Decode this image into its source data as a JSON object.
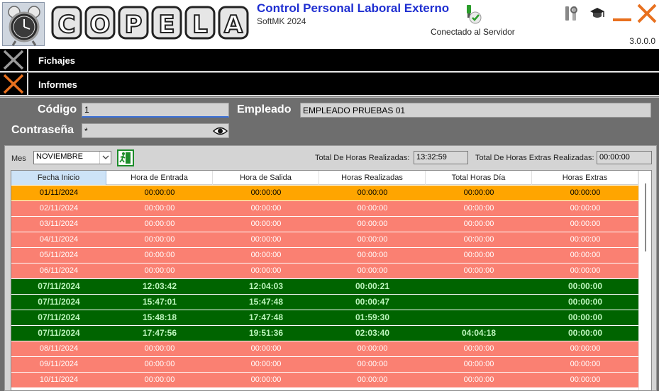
{
  "header": {
    "app_title": "Control Personal Laboral Externo",
    "app_subtitle": "SoftMK 2024",
    "connection_status": "Conectado al Servidor",
    "version": "3.0.0.0",
    "logo_letters": [
      "C",
      "O",
      "P",
      "E",
      "L",
      "A"
    ],
    "icons": [
      "clock-logo-icon",
      "server-connected-icon",
      "tools-icon",
      "graduation-cap-icon",
      "minimize-icon",
      "close-icon"
    ]
  },
  "menu": {
    "items": [
      {
        "label": "Fichajes",
        "icon": "cross-icon",
        "color": "#9a9a9a"
      },
      {
        "label": "Informes",
        "icon": "cross-icon",
        "color": "#e8701e"
      }
    ]
  },
  "form": {
    "codigo_label": "Código",
    "codigo_value": "1",
    "empleado_label": "Empleado",
    "empleado_value": "EMPLEADO PRUEBAS 01",
    "password_label": "Contraseña",
    "password_value": "*"
  },
  "report": {
    "mes_label": "Mes",
    "mes_selected": "NOVIEMBRE",
    "total_label": "Total De Horas Realizadas:",
    "total_value": "13:32:59",
    "extras_label": "Total De Horas Extras Realizadas:",
    "extras_value": "00:00:00",
    "columns": [
      "Fecha Inicio",
      "Hora de Entrada",
      "Hora de Salida",
      "Horas Realizadas",
      "Total Horas Día",
      "Horas Extras"
    ],
    "row_colors": {
      "orange": "#ffa500",
      "salmon": "#fa8072",
      "green": "#006400"
    },
    "rows": [
      {
        "style": "orange",
        "cells": [
          "01/11/2024",
          "00:00:00",
          "00:00:00",
          "00:00:00",
          "00:00:00",
          "00:00:00"
        ]
      },
      {
        "style": "salmon",
        "cells": [
          "02/11/2024",
          "00:00:00",
          "00:00:00",
          "00:00:00",
          "00:00:00",
          "00:00:00"
        ]
      },
      {
        "style": "salmon",
        "cells": [
          "03/11/2024",
          "00:00:00",
          "00:00:00",
          "00:00:00",
          "00:00:00",
          "00:00:00"
        ]
      },
      {
        "style": "salmon",
        "cells": [
          "04/11/2024",
          "00:00:00",
          "00:00:00",
          "00:00:00",
          "00:00:00",
          "00:00:00"
        ]
      },
      {
        "style": "salmon",
        "cells": [
          "05/11/2024",
          "00:00:00",
          "00:00:00",
          "00:00:00",
          "00:00:00",
          "00:00:00"
        ]
      },
      {
        "style": "salmon",
        "cells": [
          "06/11/2024",
          "00:00:00",
          "00:00:00",
          "00:00:00",
          "00:00:00",
          "00:00:00"
        ]
      },
      {
        "style": "green",
        "cells": [
          "07/11/2024",
          "12:03:42",
          "12:04:03",
          "00:00:21",
          "",
          "00:00:00"
        ]
      },
      {
        "style": "green",
        "cells": [
          "07/11/2024",
          "15:47:01",
          "15:47:48",
          "00:00:47",
          "",
          "00:00:00"
        ]
      },
      {
        "style": "green",
        "cells": [
          "07/11/2024",
          "15:48:18",
          "17:47:48",
          "01:59:30",
          "",
          "00:00:00"
        ]
      },
      {
        "style": "green",
        "cells": [
          "07/11/2024",
          "17:47:56",
          "19:51:36",
          "02:03:40",
          "04:04:18",
          "00:00:00"
        ]
      },
      {
        "style": "salmon",
        "cells": [
          "08/11/2024",
          "00:00:00",
          "00:00:00",
          "00:00:00",
          "00:00:00",
          "00:00:00"
        ]
      },
      {
        "style": "salmon",
        "cells": [
          "09/11/2024",
          "00:00:00",
          "00:00:00",
          "00:00:00",
          "00:00:00",
          "00:00:00"
        ]
      },
      {
        "style": "salmon",
        "cells": [
          "10/11/2024",
          "00:00:00",
          "00:00:00",
          "00:00:00",
          "00:00:00",
          "00:00:00"
        ]
      }
    ]
  }
}
